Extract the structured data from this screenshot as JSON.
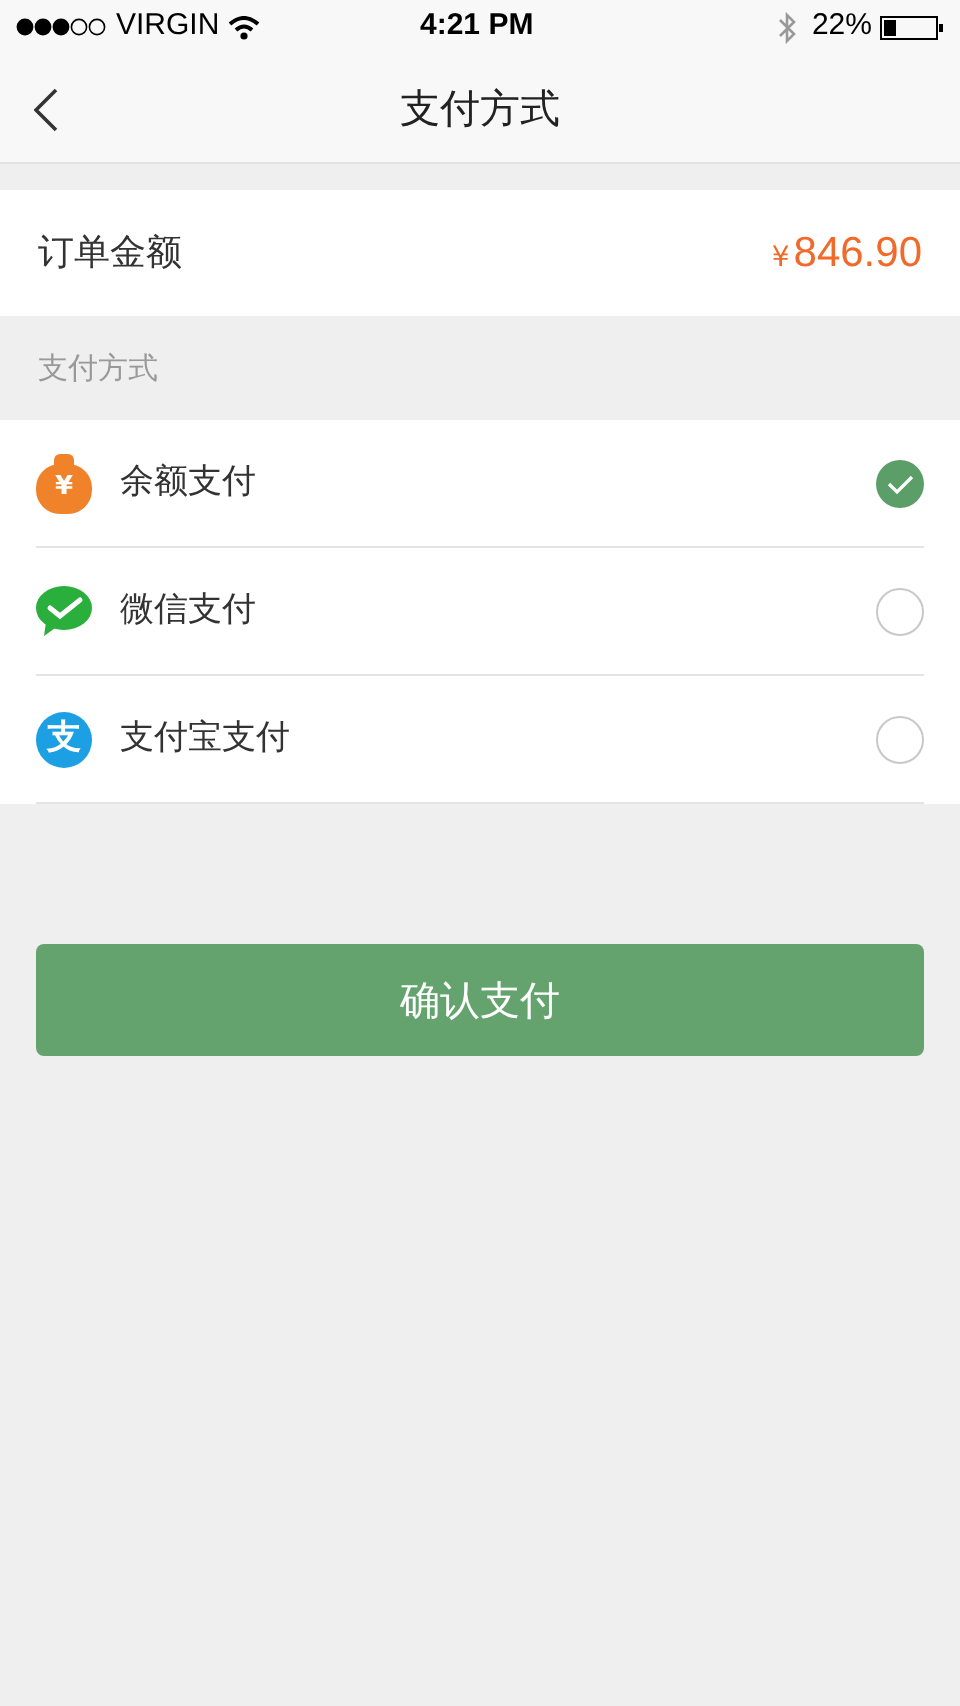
{
  "status_bar": {
    "carrier": "VIRGIN",
    "time": "4:21 PM",
    "battery": "22%"
  },
  "nav": {
    "title": "支付方式"
  },
  "order": {
    "label": "订单金额",
    "currency": "¥",
    "amount": "846.90"
  },
  "section_label": "支付方式",
  "methods": [
    {
      "kind": "balance",
      "icon_text": "¥",
      "label": "余额支付",
      "selected": true
    },
    {
      "kind": "wechat",
      "label": "微信支付",
      "selected": false
    },
    {
      "kind": "alipay",
      "icon_text": "支",
      "label": "支付宝支付",
      "selected": false
    }
  ],
  "confirm_button": "确认支付"
}
